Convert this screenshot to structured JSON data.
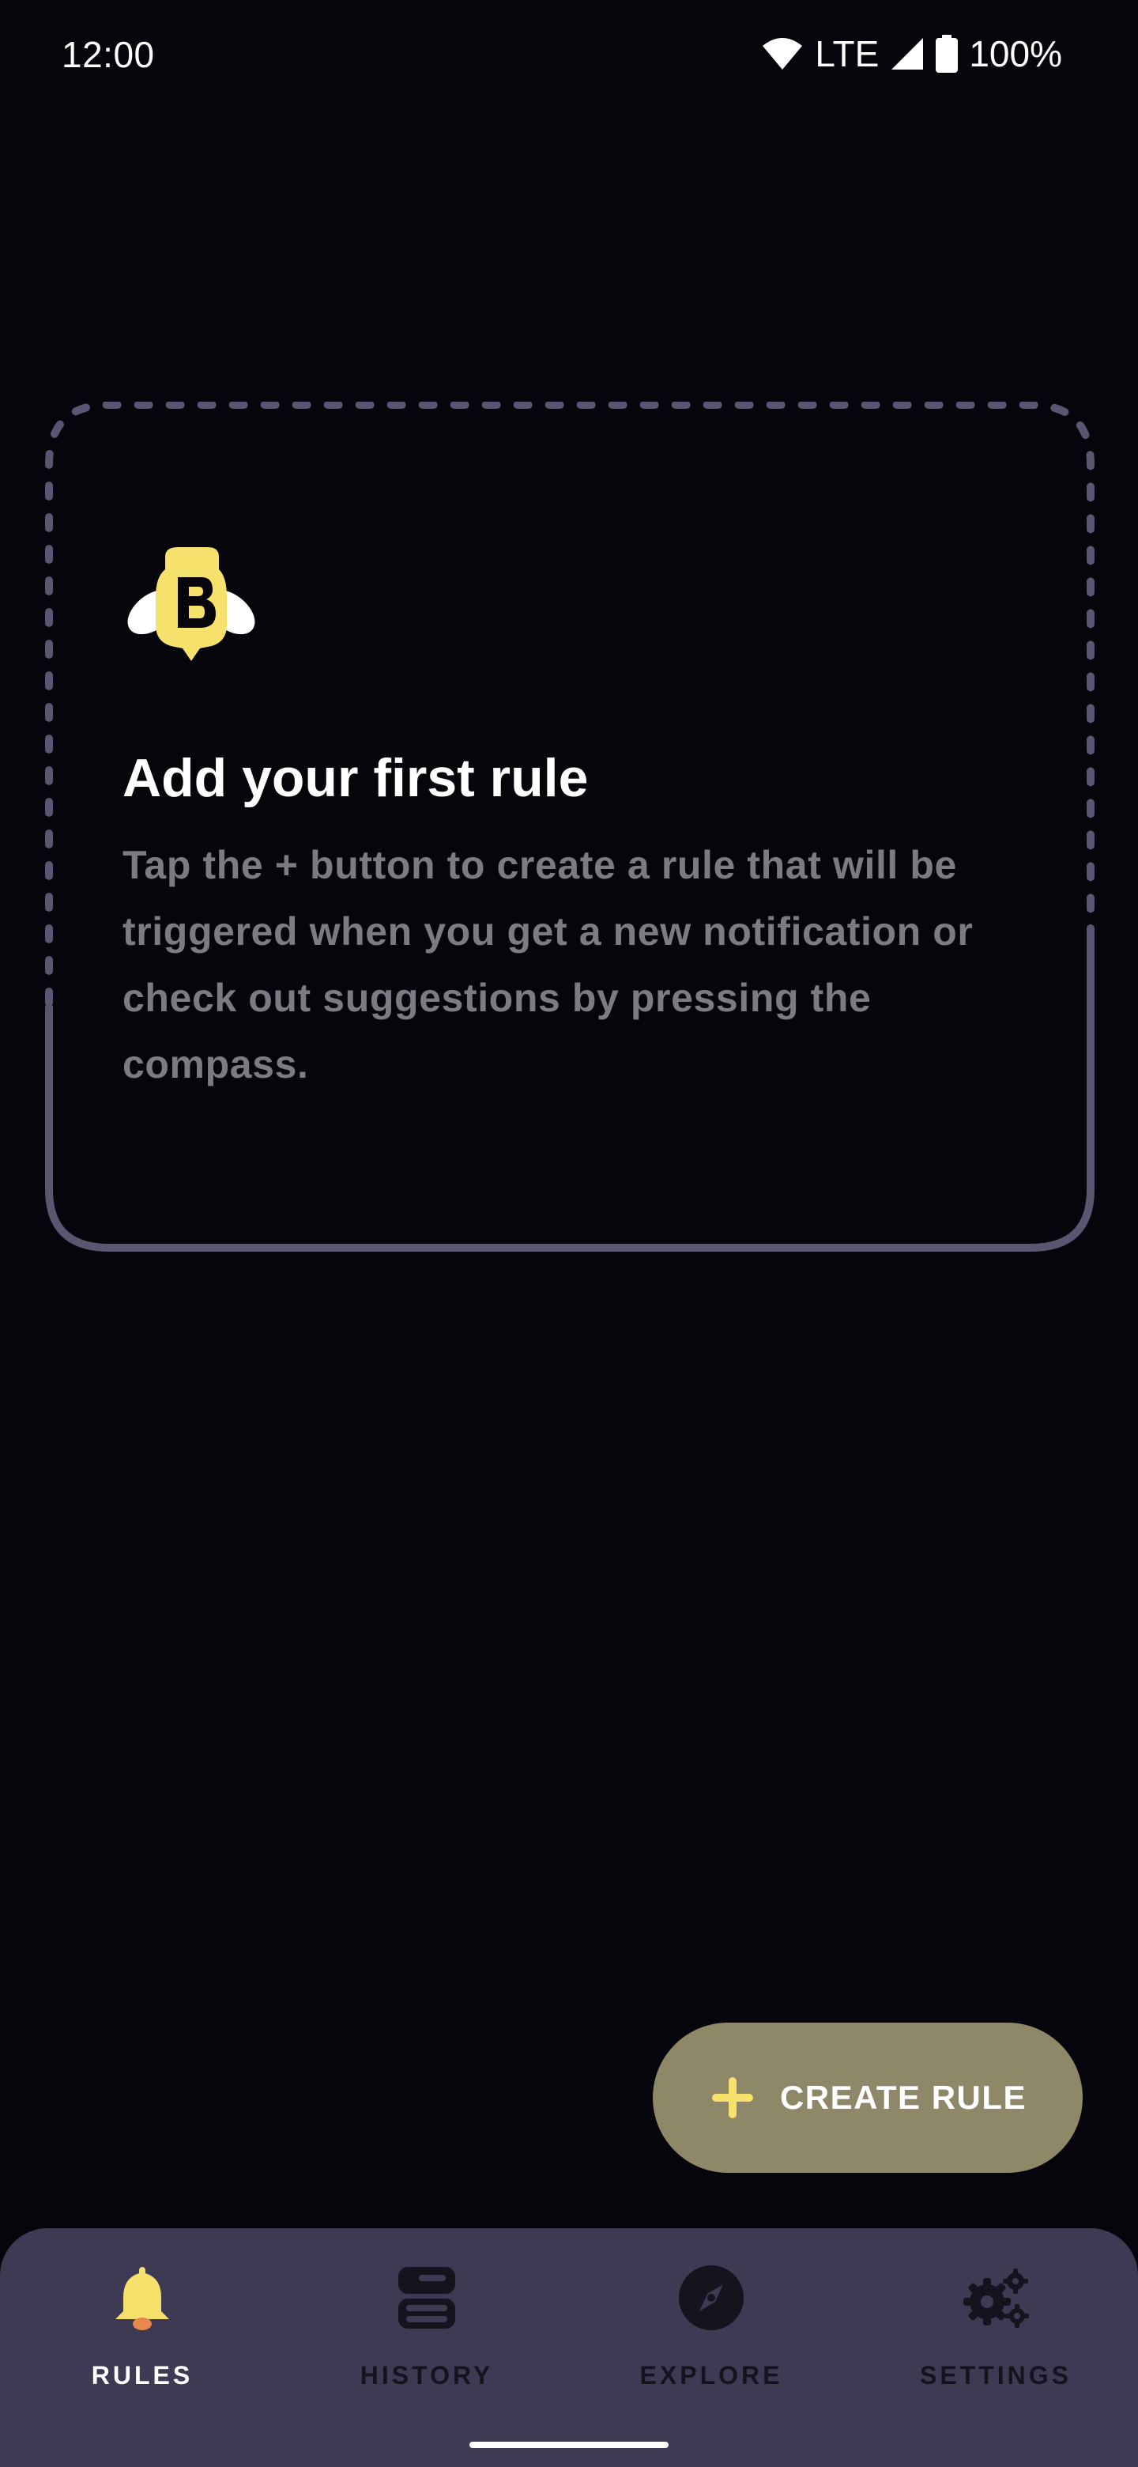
{
  "status_bar": {
    "time": "12:00",
    "network": "LTE",
    "battery": "100%",
    "icons": [
      "wifi-icon",
      "cell-signal-icon",
      "battery-icon"
    ]
  },
  "empty_state": {
    "logo_icon": "bee-logo-icon",
    "title": "Add your first rule",
    "body": "Tap the + button to create a rule that will be triggered when you get a new notification or check out suggestions by pressing the compass."
  },
  "fab": {
    "icon": "plus-icon",
    "label": "CREATE RULE"
  },
  "bottom_nav": {
    "items": [
      {
        "label": "RULES",
        "icon": "bell-icon",
        "active": true
      },
      {
        "label": "HISTORY",
        "icon": "history-icon",
        "active": false
      },
      {
        "label": "EXPLORE",
        "icon": "compass-icon",
        "active": false
      },
      {
        "label": "SETTINGS",
        "icon": "gears-icon",
        "active": false
      }
    ]
  },
  "colors": {
    "background": "#06050b",
    "card_border": "#5a5672",
    "accent_yellow": "#f7e16d",
    "fab_background": "#8e8768",
    "nav_background": "#3e3a53",
    "body_text": "#7c7b82"
  }
}
